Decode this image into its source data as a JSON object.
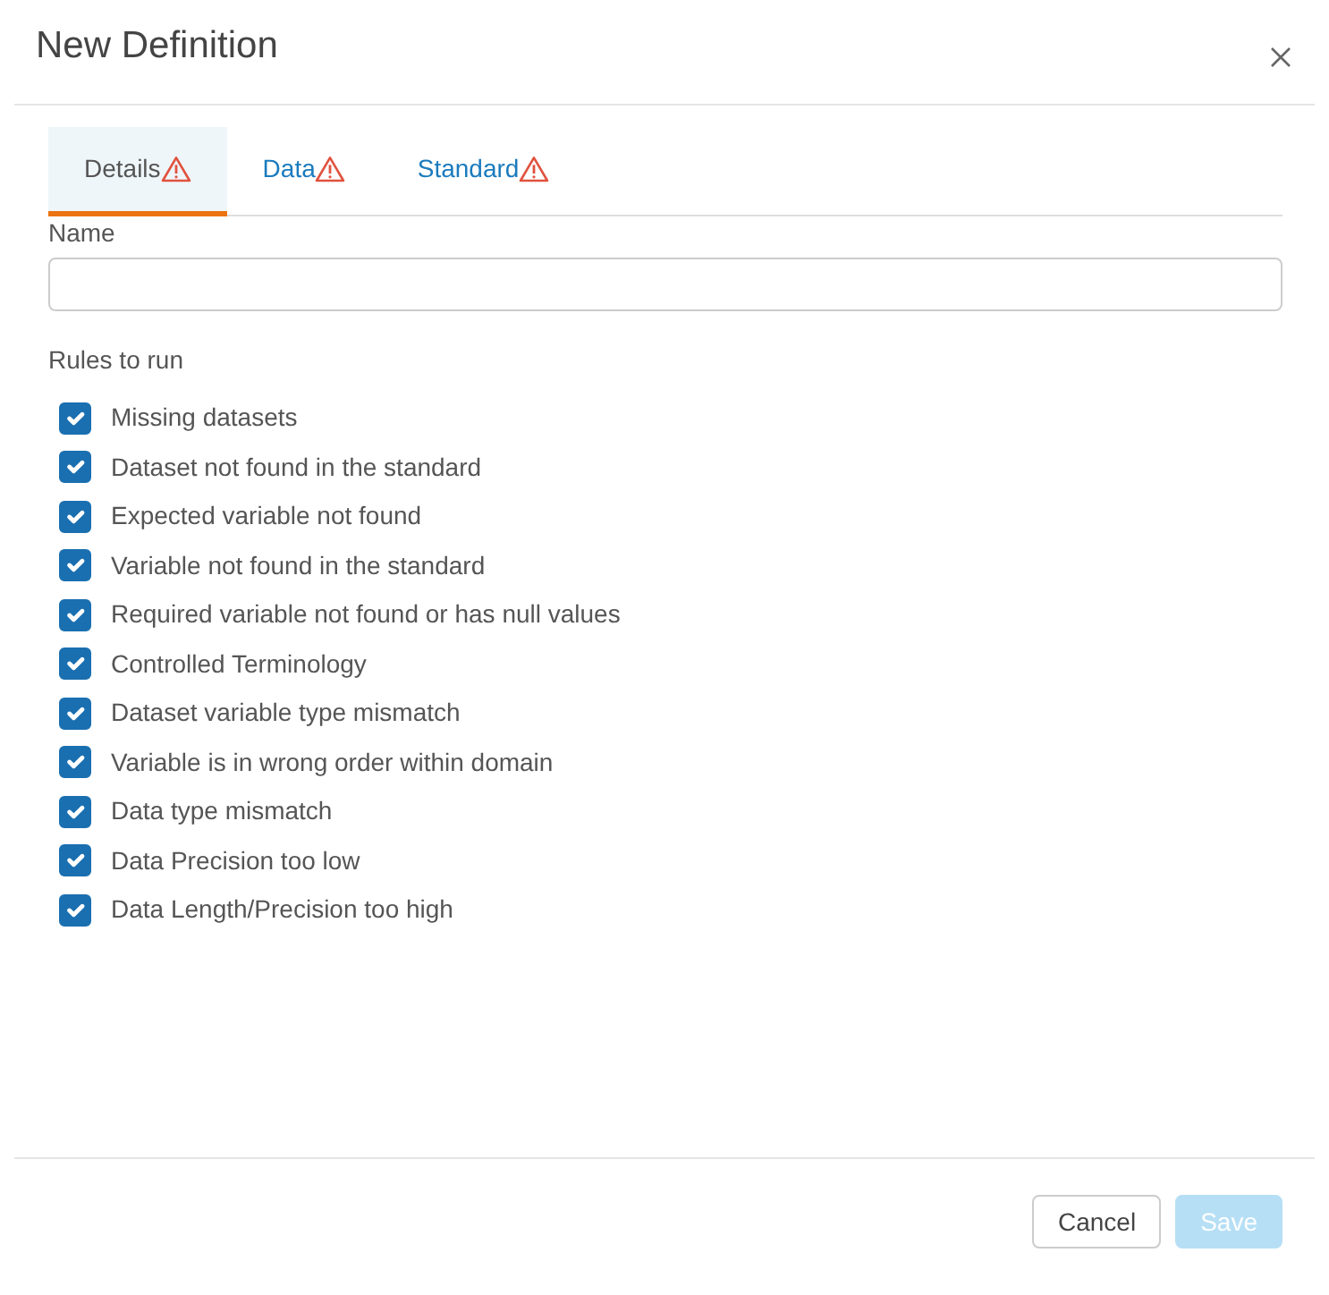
{
  "dialog": {
    "title": "New Definition"
  },
  "tabs": [
    {
      "label": "Details",
      "selected": true,
      "warning": true
    },
    {
      "label": "Data",
      "selected": false,
      "warning": true
    },
    {
      "label": "Standard",
      "selected": false,
      "warning": true
    }
  ],
  "name_field": {
    "label": "Name"
  },
  "rules": {
    "heading": "Rules to run",
    "items": [
      {
        "label": "Missing datasets",
        "checked": true
      },
      {
        "label": "Dataset not found in the standard",
        "checked": true
      },
      {
        "label": "Expected variable not found",
        "checked": true
      },
      {
        "label": "Variable not found in the standard",
        "checked": true
      },
      {
        "label": "Required variable not found or has null values",
        "checked": true
      },
      {
        "label": "Controlled Terminology",
        "checked": true
      },
      {
        "label": "Dataset variable type mismatch",
        "checked": true
      },
      {
        "label": "Variable is in wrong order within domain",
        "checked": true
      },
      {
        "label": "Data type mismatch",
        "checked": true
      },
      {
        "label": "Data Precision too low",
        "checked": true
      },
      {
        "label": "Data Length/Precision too high",
        "checked": true
      }
    ]
  },
  "buttons": [
    {
      "label": "Cancel",
      "kind": "secondary",
      "disabled": false
    },
    {
      "label": "Save",
      "kind": "primary",
      "disabled": true
    }
  ]
}
